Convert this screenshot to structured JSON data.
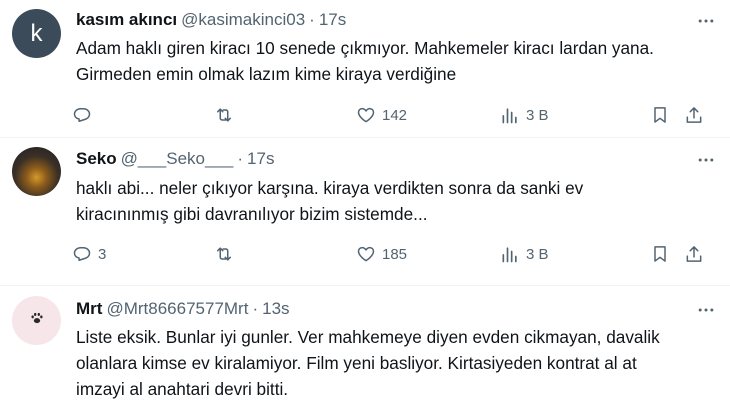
{
  "tweets": [
    {
      "avatar_letter": "k",
      "name": "kasım akıncı",
      "handle": "@kasimakinci03",
      "time": "17s",
      "lines": [
        "Adam haklı giren kiracı 10 senede çıkmıyor. Mahkemeler kiracı lardan yana.",
        "Girmeden emin olmak lazım kime kiraya verdiğine"
      ],
      "replies": "",
      "retweets": "",
      "likes": "142",
      "views": "3 B"
    },
    {
      "name": "Seko",
      "handle": "@___Seko___",
      "time": "17s",
      "lines": [
        "haklı abi... neler çıkıyor karşına. kiraya verdikten sonra da sanki ev",
        "kiracınınmış gibi davranılıyor bizim sistemde..."
      ],
      "replies": "3",
      "retweets": "",
      "likes": "185",
      "views": "3 B"
    },
    {
      "name": "Mrt",
      "handle": "@Mrt86667577Mrt",
      "time": "13s",
      "lines": [
        "Liste eksik. Bunlar iyi gunler. Ver mahkemeye diyen evden cikmayan, davalik",
        "olanlara kimse ev kiralamiyor. Film yeni basliyor. Kirtasiyeden kontrat al at",
        "imzayi al anahtari devri bitti."
      ]
    }
  ],
  "separator": "·",
  "icons": {
    "more": "more-horizontal-icon",
    "reply": "reply-icon",
    "retweet": "retweet-icon",
    "like": "heart-icon",
    "views": "views-chart-icon",
    "bookmark": "bookmark-icon",
    "share": "share-icon",
    "mrt_avatar": "paw-icon"
  },
  "colors": {
    "text": "#0f1419",
    "secondary": "#536471",
    "divider": "#eff3f4"
  }
}
